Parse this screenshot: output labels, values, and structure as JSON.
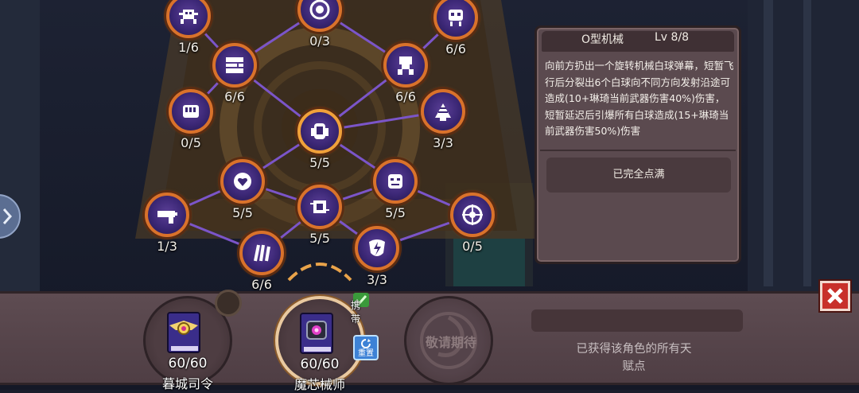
{
  "tree": {
    "nodes": [
      {
        "icon": "spider-bot-icon",
        "count": "1/6"
      },
      {
        "icon": "eye-core-icon",
        "count": "0/3"
      },
      {
        "icon": "skull-bot-icon",
        "count": "6/6"
      },
      {
        "icon": "terminal-icon",
        "count": "6/6"
      },
      {
        "icon": "turret-icon",
        "count": "6/6"
      },
      {
        "icon": "fist-icon",
        "count": "0/5"
      },
      {
        "icon": "orb-machine-icon",
        "count": "5/5"
      },
      {
        "icon": "shuttlecock-icon",
        "count": "3/3"
      },
      {
        "icon": "gear-heart-icon",
        "count": "5/5"
      },
      {
        "icon": "robot-face-icon",
        "count": "5/5"
      },
      {
        "icon": "blaster-gun-icon",
        "count": "1/3"
      },
      {
        "icon": "circuit-chip-icon",
        "count": "5/5"
      },
      {
        "icon": "target-reticle-icon",
        "count": "0/5"
      },
      {
        "icon": "claw-mark-icon",
        "count": "6/6"
      },
      {
        "icon": "lightning-shield-icon",
        "count": "3/3"
      }
    ]
  },
  "detail_panel": {
    "title": "O型机械",
    "level": "Lv 8/8",
    "description": "向前方扔出一个旋转机械白球弹幕，短暂飞行后分裂出6个白球向不同方向发射沿途可造成(10+琳琦当前武器伤害40%)伤害，短暂延迟后引爆所有白球造成(15+琳琦当前武器伤害50%)伤害",
    "status_button": "已完全点满"
  },
  "talent_books": [
    {
      "name": "暮城司令",
      "value": "60/60"
    },
    {
      "name": "魔芯械师",
      "value": "60/60",
      "badge": "携带",
      "reset_label": "重置"
    },
    {
      "name": "",
      "value": "",
      "placeholder": "敬请期待"
    }
  ],
  "info_text": "已获得该角色的所有天赋点",
  "colors": {
    "node_border": "#d9722b",
    "node_fill": "#3b2775",
    "panel_bg": "#5b4a4f",
    "close_red": "#c8302a",
    "accent_gold": "#e9a34a"
  }
}
